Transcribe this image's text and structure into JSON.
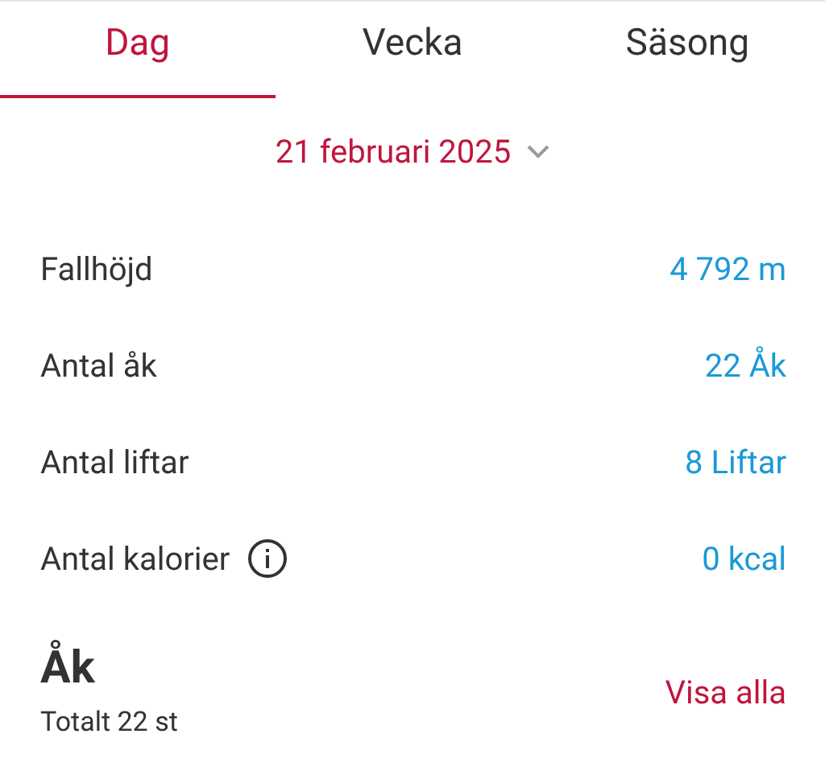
{
  "tabs": [
    {
      "label": "Dag",
      "selected": true
    },
    {
      "label": "Vecka",
      "selected": false
    },
    {
      "label": "Säsong",
      "selected": false
    }
  ],
  "date": "21 februari 2025",
  "stats": [
    {
      "label": "Fallhöjd",
      "value": "4 792 m",
      "kind": "plain"
    },
    {
      "label": "Antal åk",
      "value": "22 Åk",
      "kind": "plain"
    },
    {
      "label": "Antal liftar",
      "value": "8 Liftar",
      "kind": "plain"
    },
    {
      "label": "Antal kalorier",
      "value": "0 kcal",
      "kind": "info"
    }
  ],
  "runs": {
    "title": "Åk",
    "subtitle": "Totalt 22 st",
    "link": "Visa alla"
  }
}
